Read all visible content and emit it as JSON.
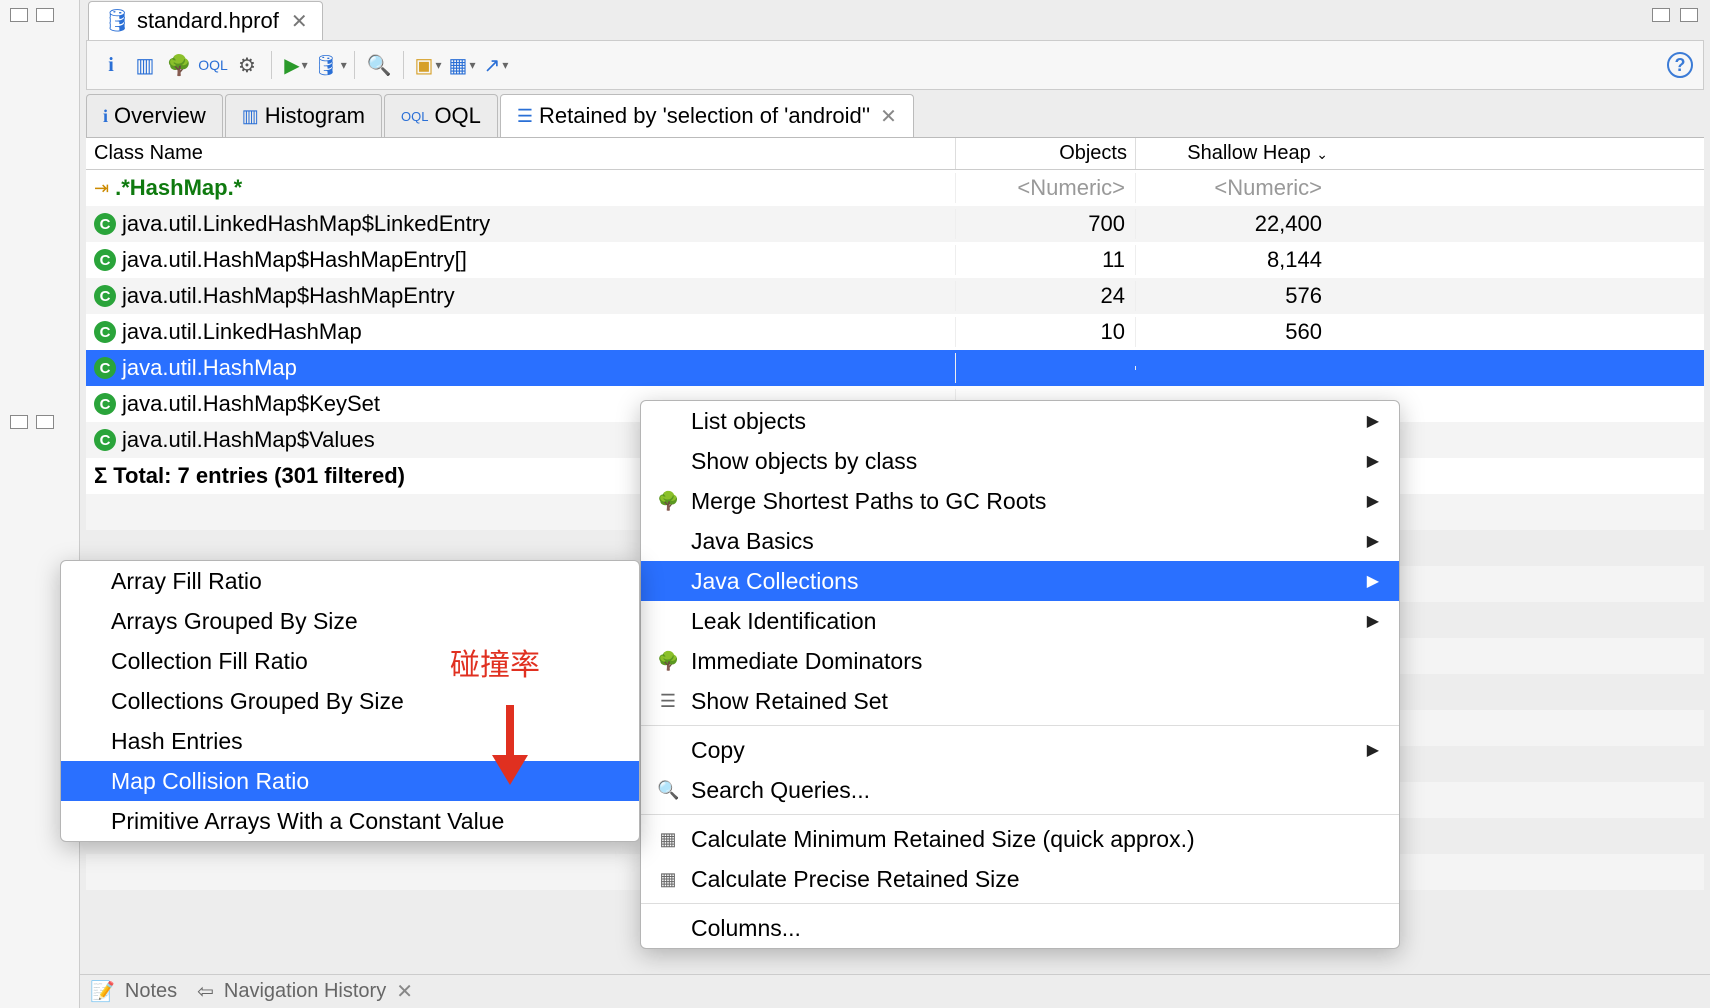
{
  "file_tab": {
    "label": "standard.hprof"
  },
  "sub_tabs": {
    "overview": "Overview",
    "histogram": "Histogram",
    "oql": "OQL",
    "retained": "Retained by 'selection of 'android''"
  },
  "columns": {
    "name": "Class Name",
    "objects": "Objects",
    "heap": "Shallow Heap"
  },
  "regex_row": {
    "pattern": ".*HashMap.*",
    "num_placeholder1": "<Numeric>",
    "num_placeholder2": "<Numeric>"
  },
  "rows": [
    {
      "name": "java.util.LinkedHashMap$LinkedEntry",
      "objects": "700",
      "heap": "22,400"
    },
    {
      "name": "java.util.HashMap$HashMapEntry[]",
      "objects": "11",
      "heap": "8,144"
    },
    {
      "name": "java.util.HashMap$HashMapEntry",
      "objects": "24",
      "heap": "576"
    },
    {
      "name": "java.util.LinkedHashMap",
      "objects": "10",
      "heap": "560"
    },
    {
      "name": "java.util.HashMap",
      "objects": "",
      "heap": ""
    },
    {
      "name": "java.util.HashMap$KeySet",
      "objects": "",
      "heap": ""
    },
    {
      "name": "java.util.HashMap$Values",
      "objects": "",
      "heap": ""
    }
  ],
  "total_row": "Total: 7 entries (301 filtered)",
  "context_menu_1": {
    "list_objects": "List objects",
    "show_by_class": "Show objects by class",
    "merge_gc": "Merge Shortest Paths to GC Roots",
    "java_basics": "Java Basics",
    "java_collections": "Java Collections",
    "leak_id": "Leak Identification",
    "imm_dom": "Immediate Dominators",
    "show_retained": "Show Retained Set",
    "copy": "Copy",
    "search_q": "Search Queries...",
    "calc_min": "Calculate Minimum Retained Size (quick approx.)",
    "calc_prec": "Calculate Precise Retained Size",
    "columns": "Columns..."
  },
  "context_menu_2": {
    "array_fill": "Array Fill Ratio",
    "arrays_grouped": "Arrays Grouped By Size",
    "coll_fill": "Collection Fill Ratio",
    "colls_grouped": "Collections Grouped By Size",
    "hash_entries": "Hash Entries",
    "map_collision": "Map Collision Ratio",
    "prim_arrays": "Primitive Arrays With a Constant Value"
  },
  "annotation": "碰撞率",
  "bottom": {
    "notes": "Notes",
    "nav": "Navigation History"
  }
}
